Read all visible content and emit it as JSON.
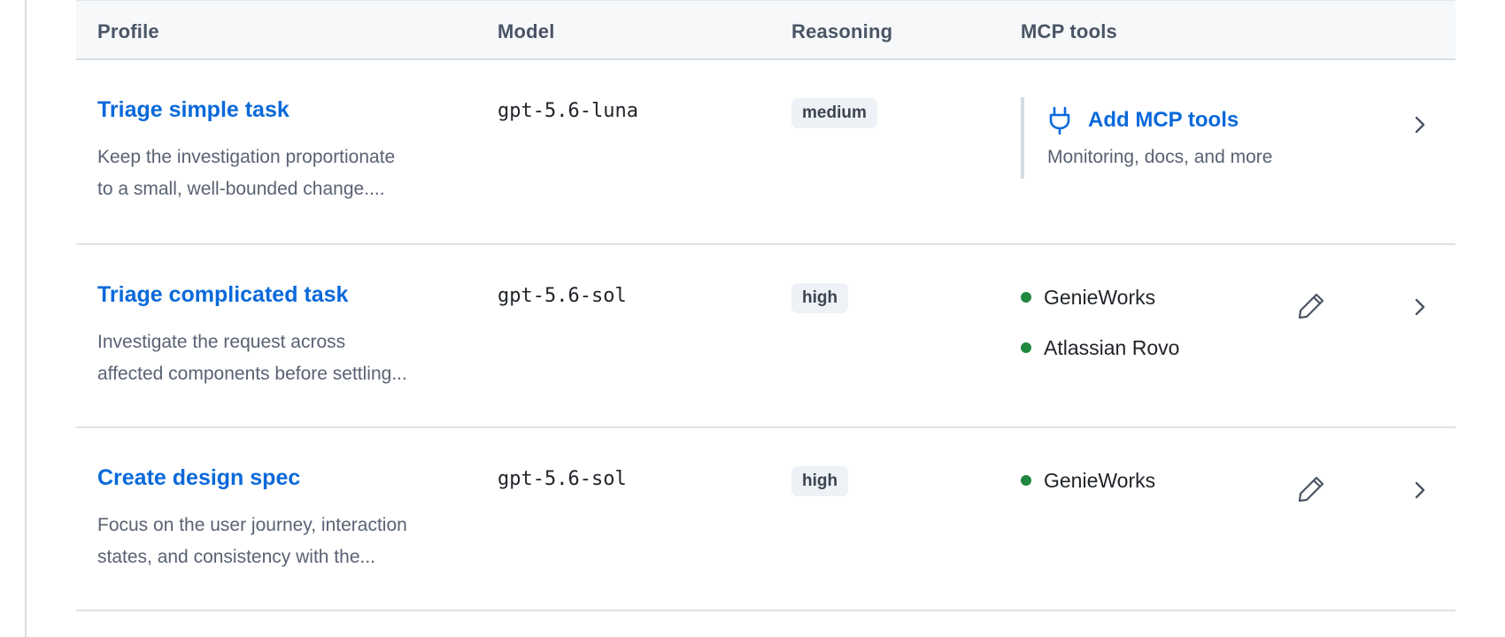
{
  "table": {
    "headers": {
      "profile": "Profile",
      "model": "Model",
      "reasoning": "Reasoning",
      "mcp_tools": "MCP tools"
    },
    "rows": [
      {
        "title": "Triage simple task",
        "description_lines": [
          "Keep the investigation proportionate",
          "to a small, well-bounded change...."
        ],
        "model": "gpt-5.6-luna",
        "reasoning": "medium",
        "mcp": {
          "add_label": "Add MCP tools",
          "add_sub": "Monitoring, docs, and more",
          "icon": "plug-icon"
        }
      },
      {
        "title": "Triage complicated task",
        "description_lines": [
          "Investigate the request across",
          "affected components before settling..."
        ],
        "model": "gpt-5.6-sol",
        "reasoning": "high",
        "tools": [
          "GenieWorks",
          "Atlassian Rovo"
        ],
        "edit_icon": "pencil-icon"
      },
      {
        "title": "Create design spec",
        "description_lines": [
          "Focus on the user journey, interaction",
          "states, and consistency with the..."
        ],
        "model": "gpt-5.6-sol",
        "reasoning": "high",
        "tools": [
          "GenieWorks"
        ],
        "edit_icon": "pencil-icon"
      }
    ]
  },
  "colors": {
    "link": "#0969da",
    "status_dot": "#1f883d",
    "header_bg": "#f6f8fa",
    "badge_bg": "#eef1f5"
  }
}
